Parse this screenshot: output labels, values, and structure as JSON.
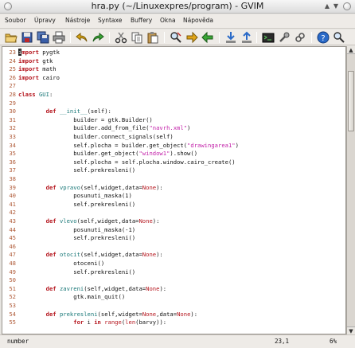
{
  "window": {
    "title": "hra.py (~/Linuxexpres/program) - GVIM"
  },
  "menu": [
    "Soubor",
    "Úpravy",
    "Nástroje",
    "Syntaxe",
    "Buffery",
    "Okna",
    "Nápověda"
  ],
  "toolbar": {
    "icons": [
      "open-icon",
      "save-icon",
      "save-all-icon",
      "print-icon",
      "undo-icon",
      "redo-icon",
      "cut-icon",
      "copy-icon",
      "paste-icon",
      "find-replace-icon",
      "find-next-icon",
      "find-prev-icon",
      "load-session-icon",
      "save-session-icon",
      "run-script-icon",
      "make-icon",
      "tags-icon",
      "help-icon",
      "find-help-icon"
    ]
  },
  "editor": {
    "lines": [
      {
        "n": "23",
        "segs": [
          [
            "cursor",
            "i"
          ],
          [
            "kw",
            "mport"
          ],
          [
            "t",
            " pygtk"
          ]
        ]
      },
      {
        "n": "24",
        "segs": [
          [
            "kw",
            "import"
          ],
          [
            "t",
            " gtk"
          ]
        ]
      },
      {
        "n": "25",
        "segs": [
          [
            "kw",
            "import"
          ],
          [
            "t",
            " math"
          ]
        ]
      },
      {
        "n": "26",
        "segs": [
          [
            "kw",
            "import"
          ],
          [
            "t",
            " cairo"
          ]
        ]
      },
      {
        "n": "27",
        "segs": []
      },
      {
        "n": "28",
        "segs": [
          [
            "kw",
            "class"
          ],
          [
            "t",
            " "
          ],
          [
            "cls",
            "GUI"
          ],
          [
            "t",
            ":"
          ]
        ]
      },
      {
        "n": "29",
        "segs": []
      },
      {
        "n": "30",
        "segs": [
          [
            "t",
            "        "
          ],
          [
            "kw",
            "def"
          ],
          [
            "t",
            " "
          ],
          [
            "fn",
            "__init__"
          ],
          [
            "t",
            "(self):"
          ]
        ]
      },
      {
        "n": "31",
        "segs": [
          [
            "t",
            "                builder = gtk.Builder()"
          ]
        ]
      },
      {
        "n": "32",
        "segs": [
          [
            "t",
            "                builder.add_from_file("
          ],
          [
            "str",
            "\"navrh.xml\""
          ],
          [
            "t",
            ")"
          ]
        ]
      },
      {
        "n": "33",
        "segs": [
          [
            "t",
            "                builder.connect_signals(self)"
          ]
        ]
      },
      {
        "n": "34",
        "segs": [
          [
            "t",
            "                self.plocha = builder.get_object("
          ],
          [
            "str",
            "\"drawingarea1\""
          ],
          [
            "t",
            ")"
          ]
        ]
      },
      {
        "n": "35",
        "segs": [
          [
            "t",
            "                builder.get_object("
          ],
          [
            "str",
            "\"window1\""
          ],
          [
            "t",
            ").show()"
          ]
        ]
      },
      {
        "n": "36",
        "segs": [
          [
            "t",
            "                self.plocha = self.plocha.window.cairo_create()"
          ]
        ]
      },
      {
        "n": "37",
        "segs": [
          [
            "t",
            "                self.prekresleni()"
          ]
        ]
      },
      {
        "n": "38",
        "segs": []
      },
      {
        "n": "39",
        "segs": [
          [
            "t",
            "        "
          ],
          [
            "kw",
            "def"
          ],
          [
            "t",
            " "
          ],
          [
            "fn",
            "vpravo"
          ],
          [
            "t",
            "(self,widget,data="
          ],
          [
            "bi",
            "None"
          ],
          [
            "t",
            "):"
          ]
        ]
      },
      {
        "n": "40",
        "segs": [
          [
            "t",
            "                posunuti_maska(1)"
          ]
        ]
      },
      {
        "n": "41",
        "segs": [
          [
            "t",
            "                self.prekresleni()"
          ]
        ]
      },
      {
        "n": "42",
        "segs": []
      },
      {
        "n": "43",
        "segs": [
          [
            "t",
            "        "
          ],
          [
            "kw",
            "def"
          ],
          [
            "t",
            " "
          ],
          [
            "fn",
            "vlevo"
          ],
          [
            "t",
            "(self,widget,data="
          ],
          [
            "bi",
            "None"
          ],
          [
            "t",
            "):"
          ]
        ]
      },
      {
        "n": "44",
        "segs": [
          [
            "t",
            "                posunuti_maska(-1)"
          ]
        ]
      },
      {
        "n": "45",
        "segs": [
          [
            "t",
            "                self.prekresleni()"
          ]
        ]
      },
      {
        "n": "46",
        "segs": []
      },
      {
        "n": "47",
        "segs": [
          [
            "t",
            "        "
          ],
          [
            "kw",
            "def"
          ],
          [
            "t",
            " "
          ],
          [
            "fn",
            "otocit"
          ],
          [
            "t",
            "(self,widget,data="
          ],
          [
            "bi",
            "None"
          ],
          [
            "t",
            "):"
          ]
        ]
      },
      {
        "n": "48",
        "segs": [
          [
            "t",
            "                otoceni()"
          ]
        ]
      },
      {
        "n": "49",
        "segs": [
          [
            "t",
            "                self.prekresleni()"
          ]
        ]
      },
      {
        "n": "50",
        "segs": []
      },
      {
        "n": "51",
        "segs": [
          [
            "t",
            "        "
          ],
          [
            "kw",
            "def"
          ],
          [
            "t",
            " "
          ],
          [
            "fn",
            "zavreni"
          ],
          [
            "t",
            "(self,widget,data="
          ],
          [
            "bi",
            "None"
          ],
          [
            "t",
            "):"
          ]
        ]
      },
      {
        "n": "52",
        "segs": [
          [
            "t",
            "                gtk.main_quit()"
          ]
        ]
      },
      {
        "n": "53",
        "segs": []
      },
      {
        "n": "54",
        "segs": [
          [
            "t",
            "        "
          ],
          [
            "kw",
            "def"
          ],
          [
            "t",
            " "
          ],
          [
            "fn",
            "prekresleni"
          ],
          [
            "t",
            "(self,widget="
          ],
          [
            "bi",
            "None"
          ],
          [
            "t",
            ",data="
          ],
          [
            "bi",
            "None"
          ],
          [
            "t",
            "):"
          ]
        ]
      },
      {
        "n": "55",
        "segs": [
          [
            "t",
            "                "
          ],
          [
            "kw",
            "for"
          ],
          [
            "t",
            " i "
          ],
          [
            "kw",
            "in"
          ],
          [
            "t",
            " "
          ],
          [
            "bi",
            "range"
          ],
          [
            "t",
            "("
          ],
          [
            "bi",
            "len"
          ],
          [
            "t",
            "(barvy)):"
          ]
        ]
      }
    ]
  },
  "scrollbar": {
    "visible_fraction": 0.22,
    "scroll_position": 0.08
  },
  "status": {
    "mode": "number",
    "position": "23,1",
    "percent": "6%"
  }
}
